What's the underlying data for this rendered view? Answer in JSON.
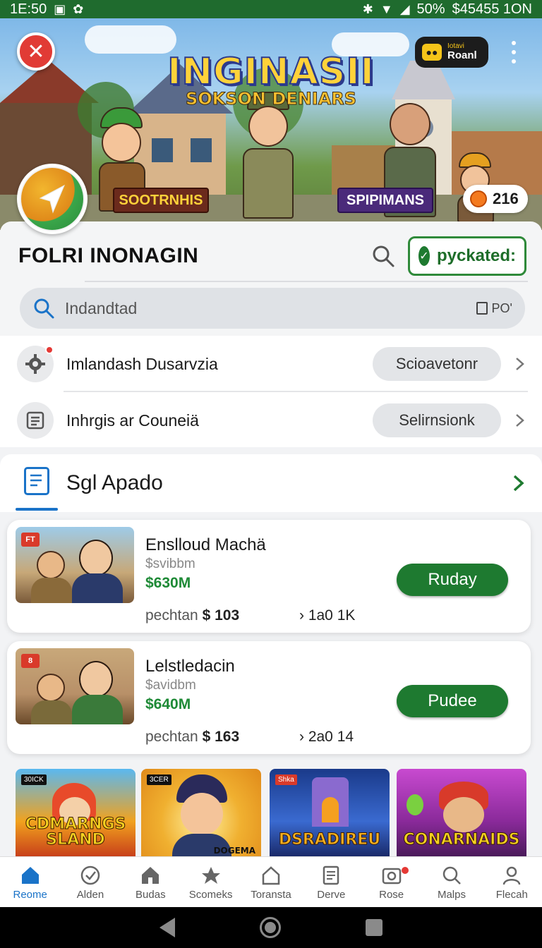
{
  "status_bar": {
    "time": "1E:50",
    "battery": "50%",
    "right_text": "$45455 1ON"
  },
  "hero": {
    "title": "INGINASII",
    "subtitle": "SOKSON DENIARS",
    "round_pill": {
      "small": "Iotavi",
      "main": "Roanl"
    },
    "tag_left": "SOOTRNHIS",
    "tag_right": "SPIPIMANS",
    "coin_count": "216"
  },
  "header": {
    "title": "FOLRI INONAGIN",
    "picked_button": "pyckated:"
  },
  "search": {
    "placeholder": "Indandtad",
    "trail": "PO'"
  },
  "settings": [
    {
      "label": "Imlandash Dusarvzia",
      "action": "Scioavetonr",
      "icon": "gear-icon"
    },
    {
      "label": "Inhrgis ar Couneiä",
      "action": "Selirnsionk",
      "icon": "document-icon"
    }
  ],
  "section": {
    "title": "Sgl Apado"
  },
  "listings": [
    {
      "badge": "FT",
      "name": "Enslloud Machä",
      "sub": "$svibbm",
      "price": "$630M",
      "meta_label": "pechtan",
      "meta_value": "$ 103",
      "meta2": "1a0 1K",
      "action": "Ruday"
    },
    {
      "badge": "8",
      "name": "Lelstledacin",
      "sub": "$avidbm",
      "price": "$640M",
      "meta_label": "pechtan",
      "meta_value": "$ 163",
      "meta2": "2a0 14",
      "action": "Pudee"
    }
  ],
  "tiles": [
    {
      "badge": "30ICK",
      "text": "CDMARNGS SLAND",
      "color": "#f1a21e"
    },
    {
      "badge": "3CER",
      "text": "DOGEMA",
      "color": "#e89a28"
    },
    {
      "badge": "Shka",
      "text": "DSRADIREU",
      "color": "#2b4fb3"
    },
    {
      "badge": "",
      "text": "CONARNAIDS",
      "color": "#b23fb0"
    }
  ],
  "bottom_nav": [
    {
      "label": "Reome",
      "icon": "home-icon",
      "active": true
    },
    {
      "label": "Alden",
      "icon": "check-circle-icon"
    },
    {
      "label": "Budas",
      "icon": "house-icon"
    },
    {
      "label": "Scomeks",
      "icon": "star-icon"
    },
    {
      "label": "Toransta",
      "icon": "tag-icon"
    },
    {
      "label": "Derve",
      "icon": "document-icon"
    },
    {
      "label": "Rose",
      "icon": "camera-icon",
      "badge": true
    },
    {
      "label": "Malps",
      "icon": "search-icon"
    },
    {
      "label": "Flecah",
      "icon": "person-icon"
    }
  ],
  "colors": {
    "status_bar": "#1f6b2e",
    "accent_green": "#1e7a30",
    "accent_blue": "#1a73c8",
    "close_red": "#e13b35"
  }
}
